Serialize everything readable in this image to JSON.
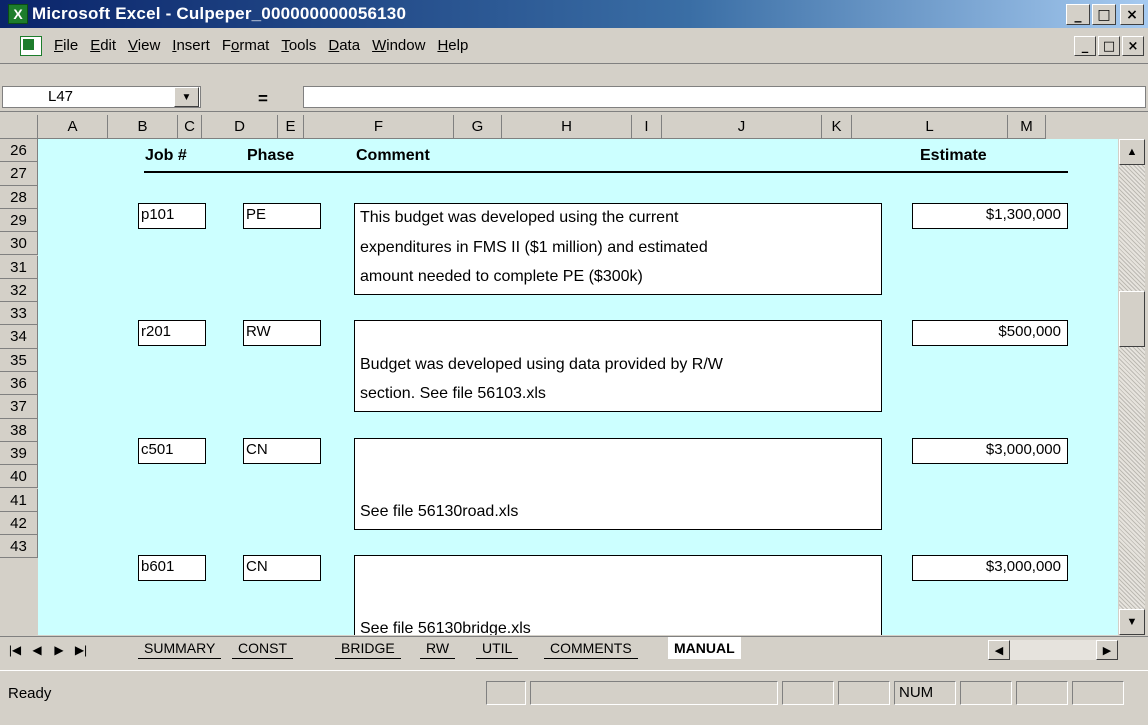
{
  "window": {
    "title": "Microsoft Excel - Culpeper_000000000056130",
    "app_icon_glyph": "X",
    "minimize_glyph": "_",
    "maximize_glyph": "□",
    "close_glyph": "×"
  },
  "menu": {
    "items": [
      {
        "label": "File",
        "ul": "F"
      },
      {
        "label": "Edit",
        "ul": "E"
      },
      {
        "label": "View",
        "ul": "V"
      },
      {
        "label": "Insert",
        "ul": "I"
      },
      {
        "label": "Format",
        "ul": "o"
      },
      {
        "label": "Tools",
        "ul": "T"
      },
      {
        "label": "Data",
        "ul": "D"
      },
      {
        "label": "Window",
        "ul": "W"
      },
      {
        "label": "Help",
        "ul": "H"
      }
    ]
  },
  "formula_bar": {
    "name_box": "L47",
    "equals": "=",
    "formula": ""
  },
  "columns": [
    "A",
    "B",
    "C",
    "D",
    "E",
    "F",
    "G",
    "H",
    "I",
    "J",
    "K",
    "L",
    "M"
  ],
  "rows": [
    "26",
    "27",
    "28",
    "29",
    "30",
    "31",
    "32",
    "33",
    "34",
    "35",
    "36",
    "37",
    "38",
    "39",
    "40",
    "41",
    "42",
    "43"
  ],
  "sheet": {
    "headers": {
      "job": "Job #",
      "phase": "Phase",
      "comment": "Comment",
      "estimate": "Estimate"
    },
    "entries": [
      {
        "job": "p101",
        "phase": "PE",
        "comment_lines": [
          "This budget was developed using the current",
          "expenditures in FMS II ($1 million) and estimated",
          "amount needed to complete PE ($300k)"
        ],
        "estimate": "$1,300,000"
      },
      {
        "job": "r201",
        "phase": "RW",
        "comment_lines": [
          "",
          "Budget was developed using data provided by R/W",
          "section.  See file 56103.xls"
        ],
        "estimate": "$500,000"
      },
      {
        "job": "c501",
        "phase": "CN",
        "comment_lines": [
          "",
          "",
          "See file 56130road.xls"
        ],
        "estimate": "$3,000,000"
      },
      {
        "job": "b601",
        "phase": "CN",
        "comment_lines": [
          "",
          "",
          "See file 56130bridge.xls"
        ],
        "estimate": "$3,000,000"
      }
    ]
  },
  "tabs": [
    "SUMMARY",
    "CONST",
    "BRIDGE",
    "RW",
    "UTIL",
    "COMMENTS",
    "MANUAL"
  ],
  "active_tab": "MANUAL",
  "status": {
    "text": "Ready",
    "num": "NUM"
  },
  "colors": {
    "sheet_background": "#ccffff",
    "title_bar": "#0a246a"
  }
}
